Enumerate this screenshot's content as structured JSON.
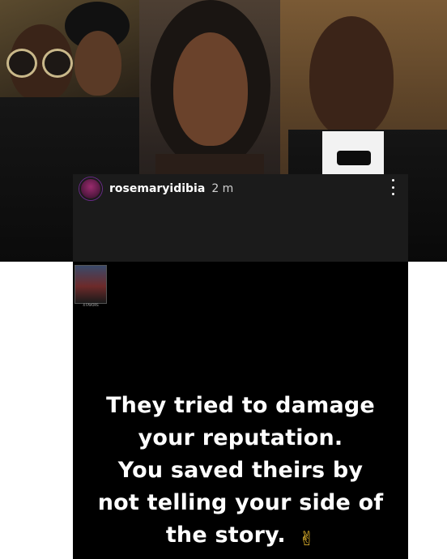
{
  "story": {
    "username": "rosemaryidibia",
    "timestamp": "2 m",
    "thumbnail_caption": "4 FAVORS",
    "lines": [
      "They tried to damage",
      "your reputation.",
      "You saved theirs by",
      "not telling your side of",
      "the story."
    ],
    "emoji": "✌"
  },
  "colors": {
    "story_bar": "#1b1b1b",
    "story_background": "#000000",
    "text": "#ffffff"
  }
}
